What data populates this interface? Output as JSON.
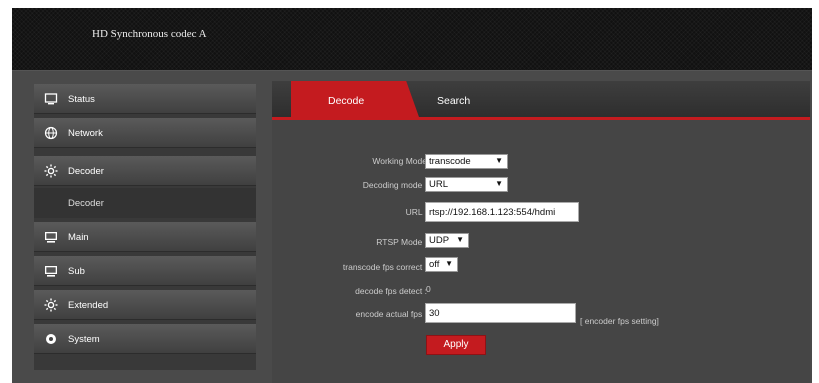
{
  "header": {
    "title": "HD Synchronous codec  A"
  },
  "sidebar": {
    "items": [
      {
        "label": "Status",
        "icon": "monitor-icon"
      },
      {
        "label": "Network",
        "icon": "globe-icon"
      },
      {
        "label": "Decoder",
        "icon": "gear-icon"
      },
      {
        "label": "Decoder",
        "icon": ""
      },
      {
        "label": "Main",
        "icon": "display-icon"
      },
      {
        "label": "Sub",
        "icon": "display-icon"
      },
      {
        "label": "Extended",
        "icon": "gear-icon"
      },
      {
        "label": "System",
        "icon": "cog-icon"
      }
    ]
  },
  "tabs": {
    "active": "Decode",
    "other": "Search"
  },
  "form": {
    "working_mode": {
      "label": "Working Mode",
      "value": "transcode"
    },
    "decoding_mode": {
      "label": "Decoding mode :",
      "value": "URL"
    },
    "url": {
      "label": "URL :",
      "value": "rtsp://192.168.1.123:554/hdmi"
    },
    "rtsp_mode": {
      "label": "RTSP Mode :",
      "value": "UDP"
    },
    "transcode_fps_correct": {
      "label": "transcode fps correct :",
      "value": "off"
    },
    "decode_fps_detect": {
      "label": "decode fps detect :",
      "value": "0"
    },
    "encode_actual_fps": {
      "label": "encode actual fps :",
      "value": "30",
      "hint": "[ encoder fps setting]"
    },
    "apply_label": "Apply"
  },
  "colors": {
    "accent": "#c41b1f",
    "panel": "#454545",
    "header": "#111111"
  }
}
